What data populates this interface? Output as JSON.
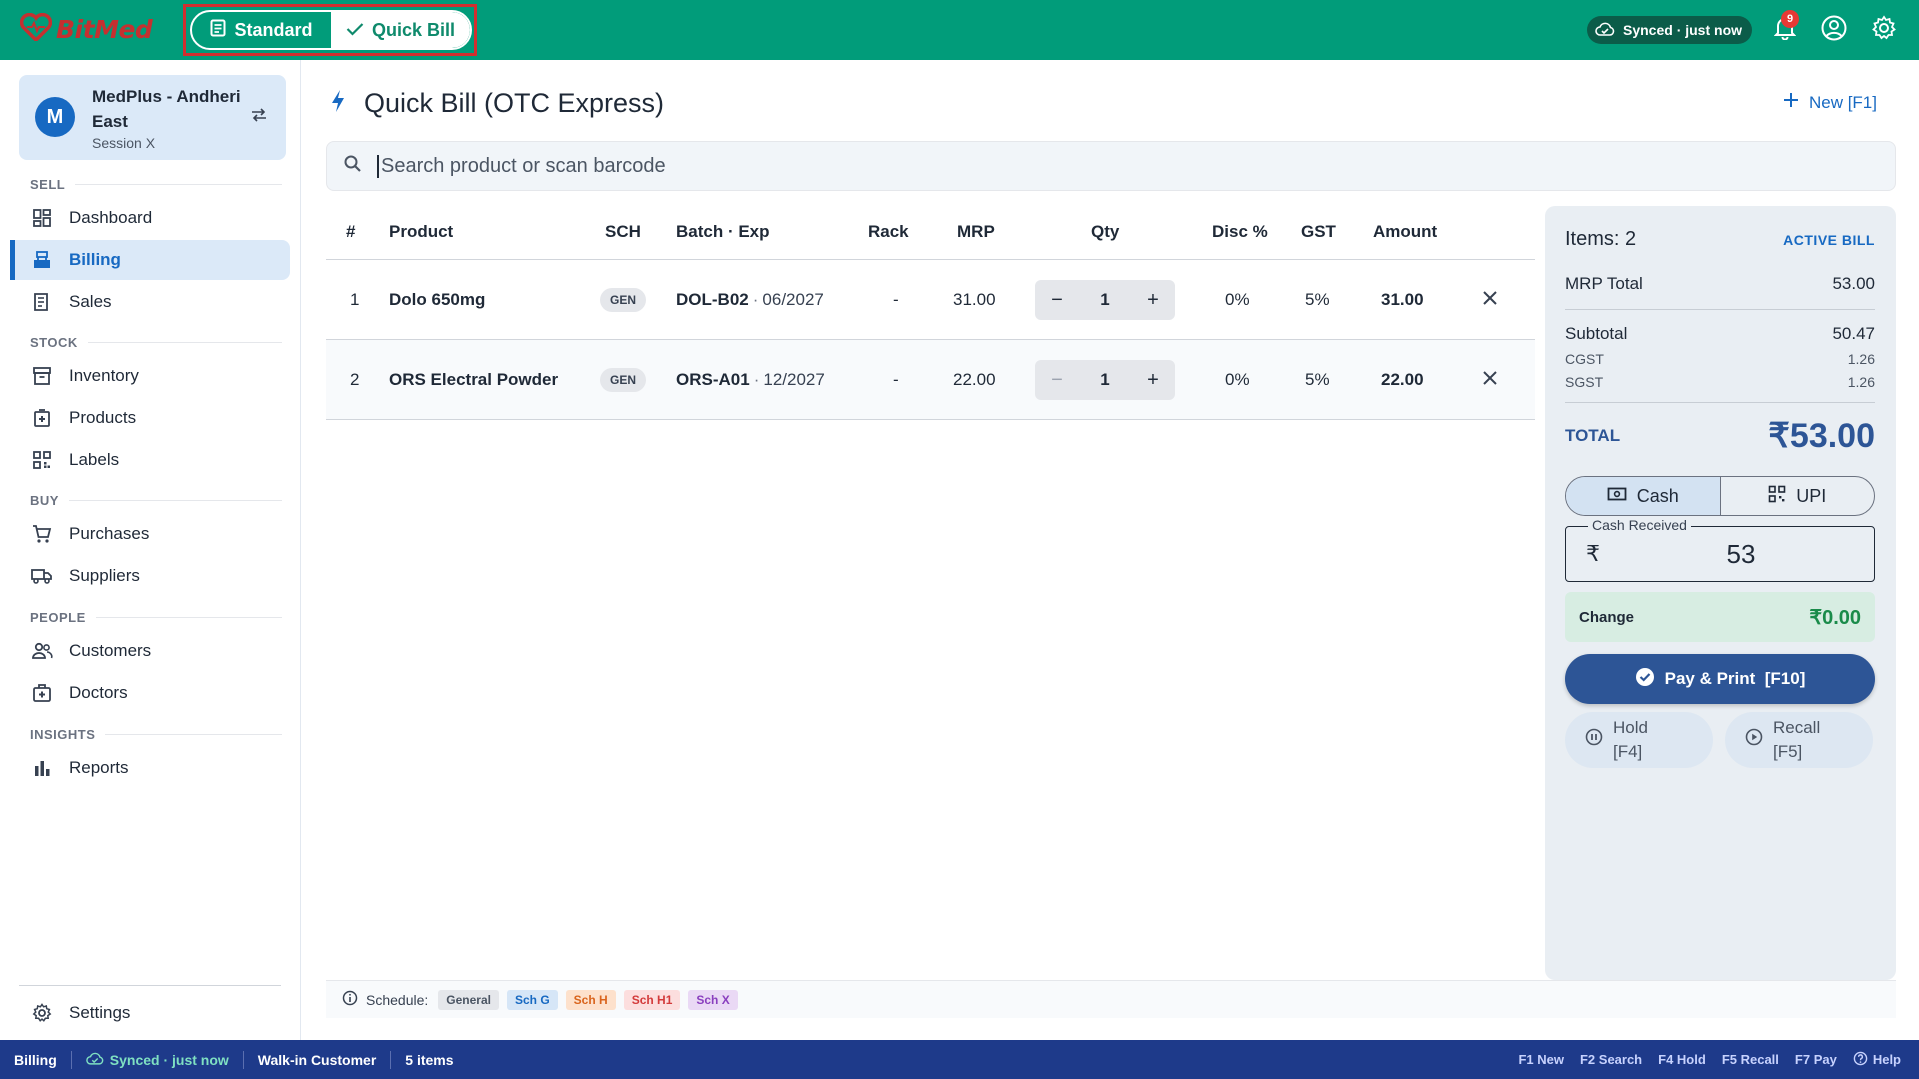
{
  "app": {
    "name": "BitMed",
    "brand_color": "#019c7a",
    "logo_icon": "heart-logo-icon"
  },
  "topbar": {
    "mode_standard": "Standard",
    "mode_quick": "Quick Bill",
    "active_mode": "Quick Bill",
    "sync_status": "Synced · just now",
    "notification_count": "9"
  },
  "sidebar": {
    "branch": {
      "avatar": "M",
      "name": "MedPlus - Andheri East",
      "session": "Session X"
    },
    "sections": {
      "sell": "SELL",
      "stock": "STOCK",
      "buy": "BUY",
      "people": "PEOPLE",
      "insights": "INSIGHTS"
    },
    "items": {
      "dashboard": "Dashboard",
      "billing": "Billing",
      "sales": "Sales",
      "inventory": "Inventory",
      "products": "Products",
      "labels": "Labels",
      "purchases": "Purchases",
      "suppliers": "Suppliers",
      "customers": "Customers",
      "doctors": "Doctors",
      "reports": "Reports",
      "settings": "Settings"
    },
    "active_item": "Billing"
  },
  "main": {
    "title": "Quick Bill (OTC Express)",
    "new_button": "New [F1]",
    "search_placeholder": "Search product or scan barcode"
  },
  "table": {
    "headers": {
      "num": "#",
      "product": "Product",
      "sch": "SCH",
      "batch_exp": "Batch · Exp",
      "rack": "Rack",
      "mrp": "MRP",
      "qty": "Qty",
      "disc": "Disc %",
      "gst": "GST",
      "amount": "Amount"
    },
    "rows": [
      {
        "num": "1",
        "product": "Dolo 650mg",
        "sch": "GEN",
        "batch": "DOL-B02",
        "exp": "06/2027",
        "rack": "-",
        "mrp": "31.00",
        "qty": "1",
        "disc": "0%",
        "gst": "5%",
        "amount": "31.00"
      },
      {
        "num": "2",
        "product": "ORS Electral Powder",
        "sch": "GEN",
        "batch": "ORS-A01",
        "exp": "12/2027",
        "rack": "-",
        "mrp": "22.00",
        "qty": "1",
        "disc": "0%",
        "gst": "5%",
        "amount": "22.00"
      }
    ]
  },
  "legend": {
    "label": "Schedule:",
    "chips": {
      "general": "General",
      "sch_g": "Sch G",
      "sch_h": "Sch H",
      "sch_h1": "Sch H1",
      "sch_x": "Sch X"
    }
  },
  "summary": {
    "items": "Items: 2",
    "badge": "ACTIVE BILL",
    "mrp_total_label": "MRP Total",
    "mrp_total": "53.00",
    "subtotal_label": "Subtotal",
    "subtotal": "50.47",
    "cgst_label": "CGST",
    "cgst": "1.26",
    "sgst_label": "SGST",
    "sgst": "1.26",
    "total_label": "TOTAL",
    "total": "₹53.00",
    "pay_cash": "Cash",
    "pay_upi": "UPI",
    "active_payment": "Cash",
    "cash_received_label": "Cash Received",
    "currency_symbol": "₹",
    "cash_received": "53",
    "change_label": "Change",
    "change": "₹0.00",
    "pay_print": "Pay & Print  [F10]",
    "hold": "Hold [F4]",
    "recall": "Recall [F5]"
  },
  "statusbar": {
    "page": "Billing",
    "sync": "Synced · just now",
    "customer": "Walk-in Customer",
    "items": "5 items",
    "shortcuts": {
      "f1": "F1 New",
      "f2": "F2 Search",
      "f4": "F4 Hold",
      "f5": "F5 Recall",
      "f7": "F7 Pay",
      "help": "Help"
    }
  }
}
